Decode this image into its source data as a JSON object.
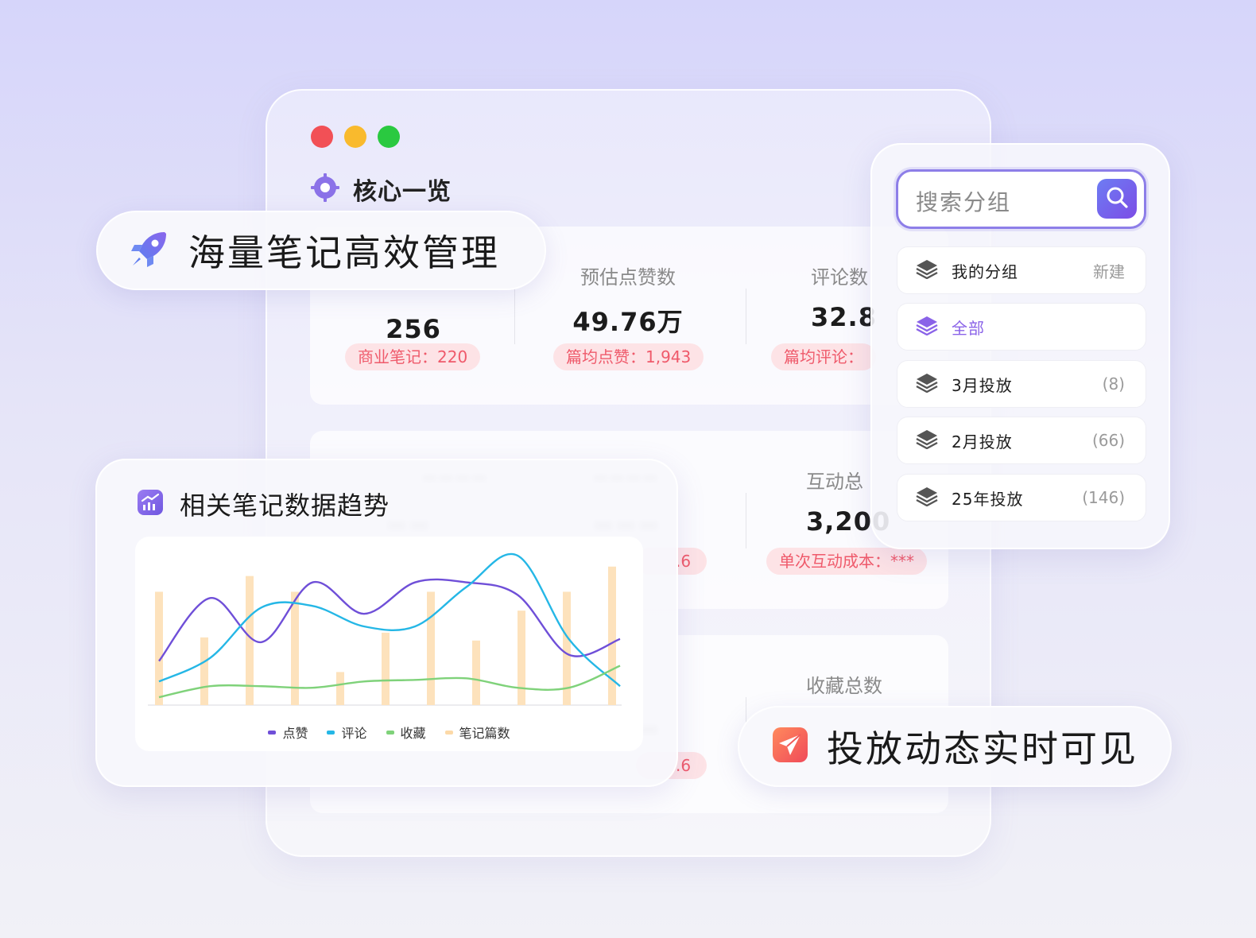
{
  "core": {
    "title": "核心一览"
  },
  "stats": [
    {
      "title": "",
      "value": "256",
      "tag": "商业笔记：220"
    },
    {
      "title": "预估点赞数",
      "value": "49.76万",
      "tag": "篇均点赞：1,943"
    },
    {
      "title": "评论数",
      "value": "32.8",
      "tag": "篇均评论："
    },
    {
      "title": "互动总",
      "value": "3,200",
      "tag": "单次互动成本：***"
    },
    {
      "title": "收藏总数",
      "value": "",
      "tag": ""
    }
  ],
  "partial_tags": [
    ".6",
    ".6"
  ],
  "badges": {
    "top": "海量笔记高效管理",
    "bottom": "投放动态实时可见"
  },
  "chart_card": {
    "title": "相关笔记数据趋势"
  },
  "chart_data": {
    "type": "line",
    "title": "相关笔记数据趋势",
    "x": [
      0,
      1,
      2,
      3,
      4,
      5,
      6,
      7,
      8,
      9,
      10
    ],
    "series": [
      {
        "name": "点赞",
        "type": "line",
        "color": "#6f4fd8",
        "values": [
          28,
          68,
          40,
          78,
          58,
          78,
          78,
          70,
          32,
          42
        ]
      },
      {
        "name": "评论",
        "type": "line",
        "color": "#25b7e6",
        "values": [
          15,
          30,
          62,
          63,
          50,
          50,
          75,
          95,
          42,
          12
        ]
      },
      {
        "name": "收藏",
        "type": "line",
        "color": "#7fd27a",
        "values": [
          5,
          12,
          12,
          11,
          15,
          16,
          17,
          11,
          11,
          25
        ]
      },
      {
        "name": "笔记篇数",
        "type": "bar",
        "color": "#fde2bc",
        "values": [
          72,
          43,
          82,
          72,
          21,
          46,
          72,
          41,
          60,
          72,
          88
        ]
      }
    ],
    "ylim": [
      0,
      100
    ],
    "grid": false,
    "legend": "bottom"
  },
  "groups": {
    "search_placeholder": "搜索分组",
    "header": {
      "label": "我的分组",
      "action": "新建"
    },
    "items": [
      {
        "label": "全部",
        "count": ""
      },
      {
        "label": "3月投放",
        "count": "(8)"
      },
      {
        "label": "2月投放",
        "count": "(66)"
      },
      {
        "label": "25年投放",
        "count": "(146)"
      }
    ]
  },
  "colors": {
    "accent": "#8a63e8",
    "tag_text": "#ef5a6b",
    "tag_bg": "#fde3e6"
  }
}
